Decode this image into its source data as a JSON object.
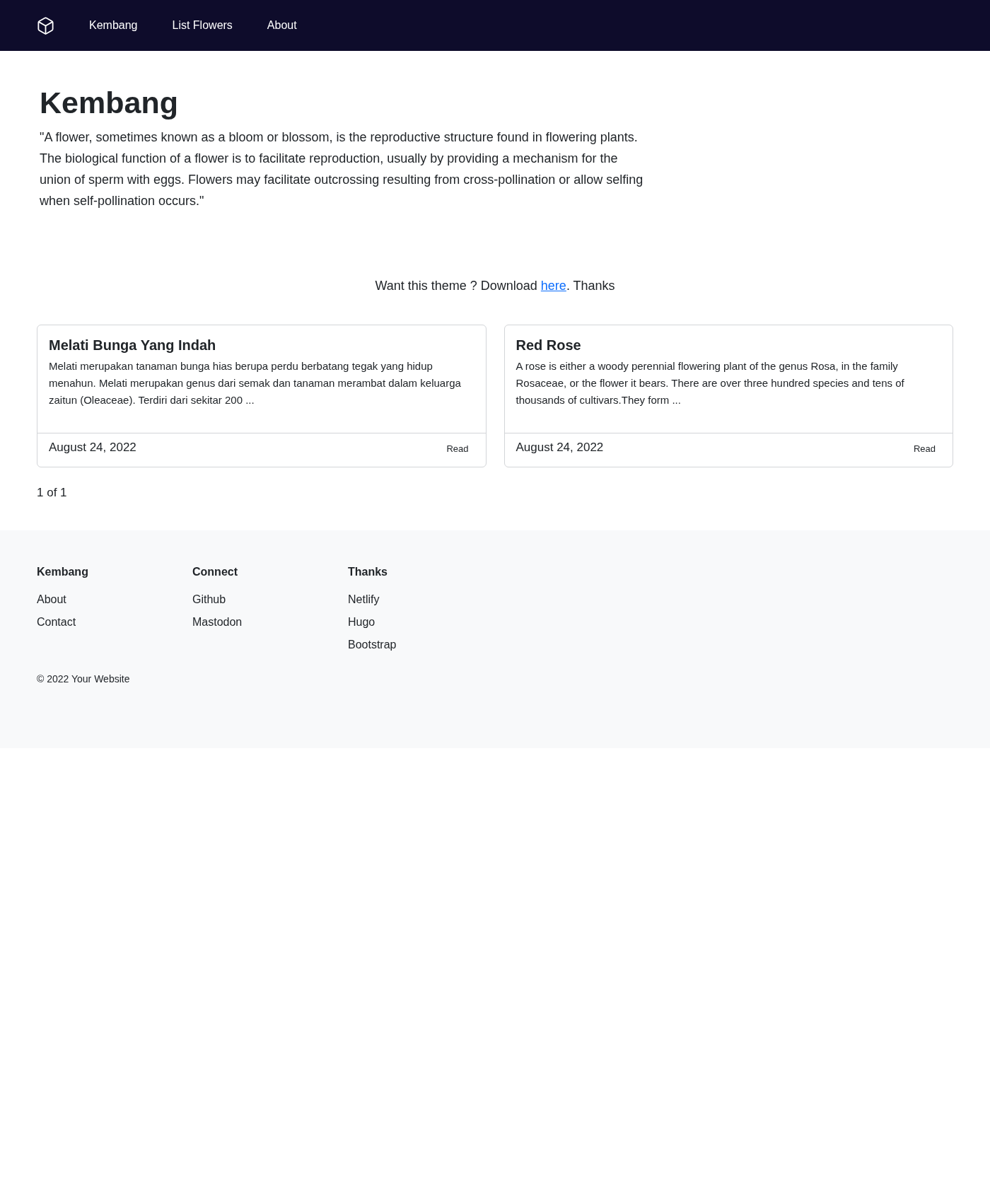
{
  "navbar": {
    "links": [
      {
        "label": "Kembang"
      },
      {
        "label": "List Flowers"
      },
      {
        "label": "About"
      }
    ]
  },
  "hero": {
    "title": "Kembang",
    "quote": "\"A flower, sometimes known as a bloom or blossom, is the reproductive structure found in flowering plants. The biological function of a flower is to facilitate reproduction, usually by providing a mechanism for the union of sperm with eggs. Flowers may facilitate outcrossing resulting from cross-pollination or allow selfing when self-pollination occurs.\""
  },
  "download_note": {
    "text_before": "Want this theme ? Download ",
    "link": "here",
    "text_after": ". Thanks"
  },
  "posts": [
    {
      "title": "Melati Bunga Yang Indah",
      "excerpt": "Melati merupakan tanaman bunga hias berupa perdu berbatang tegak yang hidup menahun. Melati merupakan genus dari semak dan tanaman merambat dalam keluarga zaitun (Oleaceae). Terdiri dari sekitar 200 ...",
      "date": "August 24, 2022",
      "action": "Read"
    },
    {
      "title": "Red Rose",
      "excerpt": "A rose is either a woody perennial flowering plant of the genus Rosa, in the family Rosaceae, or the flower it bears. There are over three hundred species and tens of thousands of cultivars.They form ...",
      "date": "August 24, 2022",
      "action": "Read"
    }
  ],
  "pagination": "1 of 1",
  "footer": {
    "columns": [
      {
        "heading": "Kembang",
        "links": [
          "About",
          "Contact"
        ]
      },
      {
        "heading": "Connect",
        "links": [
          "Github",
          "Mastodon"
        ]
      },
      {
        "heading": "Thanks",
        "links": [
          "Netlify",
          "Hugo",
          "Bootstrap"
        ]
      }
    ],
    "copyright": "© 2022 Your Website"
  }
}
